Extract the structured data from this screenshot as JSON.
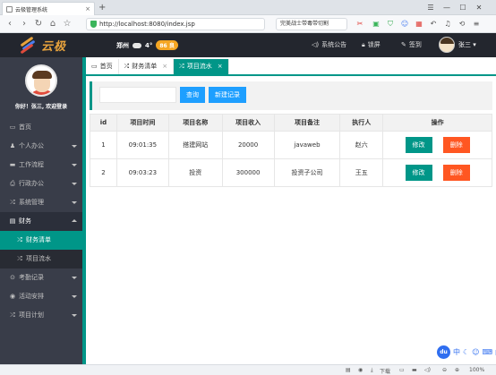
{
  "browser": {
    "tab_title": "云极管理系统",
    "url": "http://localhost:8080/index.jsp",
    "search_text": "完美战士带毒带切割",
    "zoom": "100%",
    "download_label": "下载"
  },
  "header": {
    "logo_text": "云极",
    "city": "郑州",
    "temperature": "4°",
    "aqi": "86 良",
    "notice": "系统公告",
    "lock": "锁屏",
    "signin": "签到",
    "user": "张三"
  },
  "sidebar": {
    "welcome": "你好！张三, 欢迎登录",
    "items": [
      {
        "label": "首页",
        "icon": "monitor-icon",
        "glyph": "▭",
        "arrow": false
      },
      {
        "label": "个人办公",
        "icon": "user-icon",
        "glyph": "♟",
        "arrow": true
      },
      {
        "label": "工作流程",
        "icon": "folder-icon",
        "glyph": "▬",
        "arrow": true
      },
      {
        "label": "行政办公",
        "icon": "print-icon",
        "glyph": "⎙",
        "arrow": true
      },
      {
        "label": "系统管理",
        "icon": "shuffle-icon",
        "glyph": "⤮",
        "arrow": true
      },
      {
        "label": "财务",
        "icon": "card-icon",
        "glyph": "▤",
        "arrow": true,
        "open": true
      },
      {
        "label": "考勤记录",
        "icon": "clock-icon",
        "glyph": "⊙",
        "arrow": true
      },
      {
        "label": "活动安排",
        "icon": "globe-icon",
        "glyph": "◉",
        "arrow": true
      },
      {
        "label": "项目计划",
        "icon": "shuffle-icon",
        "glyph": "⤮",
        "arrow": true
      }
    ],
    "finance_sub": [
      {
        "label": "财务清单",
        "active": true
      },
      {
        "label": "项目流水",
        "active": false
      }
    ]
  },
  "tabs": [
    {
      "label": "首页",
      "icon": "monitor-icon",
      "glyph": "▭",
      "closable": false,
      "active": false
    },
    {
      "label": "财务清单",
      "icon": "shuffle-icon",
      "glyph": "⤮",
      "closable": true,
      "active": false
    },
    {
      "label": "项目流水",
      "icon": "shuffle-icon",
      "glyph": "⤮",
      "closable": true,
      "active": true
    }
  ],
  "toolbar": {
    "search_placeholder": "",
    "query_label": "查询",
    "new_label": "新建记录"
  },
  "table": {
    "headers": [
      "id",
      "项目时间",
      "项目名称",
      "项目收入",
      "项目备注",
      "执行人",
      "操作"
    ],
    "rows": [
      [
        "1",
        "09:01:35",
        "搭建网站",
        "20000",
        "javaweb",
        "赵六"
      ],
      [
        "2",
        "09:03:23",
        "投资",
        "300000",
        "投资子公司",
        "王五"
      ]
    ],
    "edit_label": "修改",
    "delete_label": "删除"
  },
  "floating": {
    "du": "du",
    "lang": "中"
  },
  "colors": {
    "accent": "#009688",
    "blue": "#1e9fff",
    "danger": "#ff5722",
    "header_bg": "#23262e",
    "sidebar_bg": "#393d49"
  }
}
